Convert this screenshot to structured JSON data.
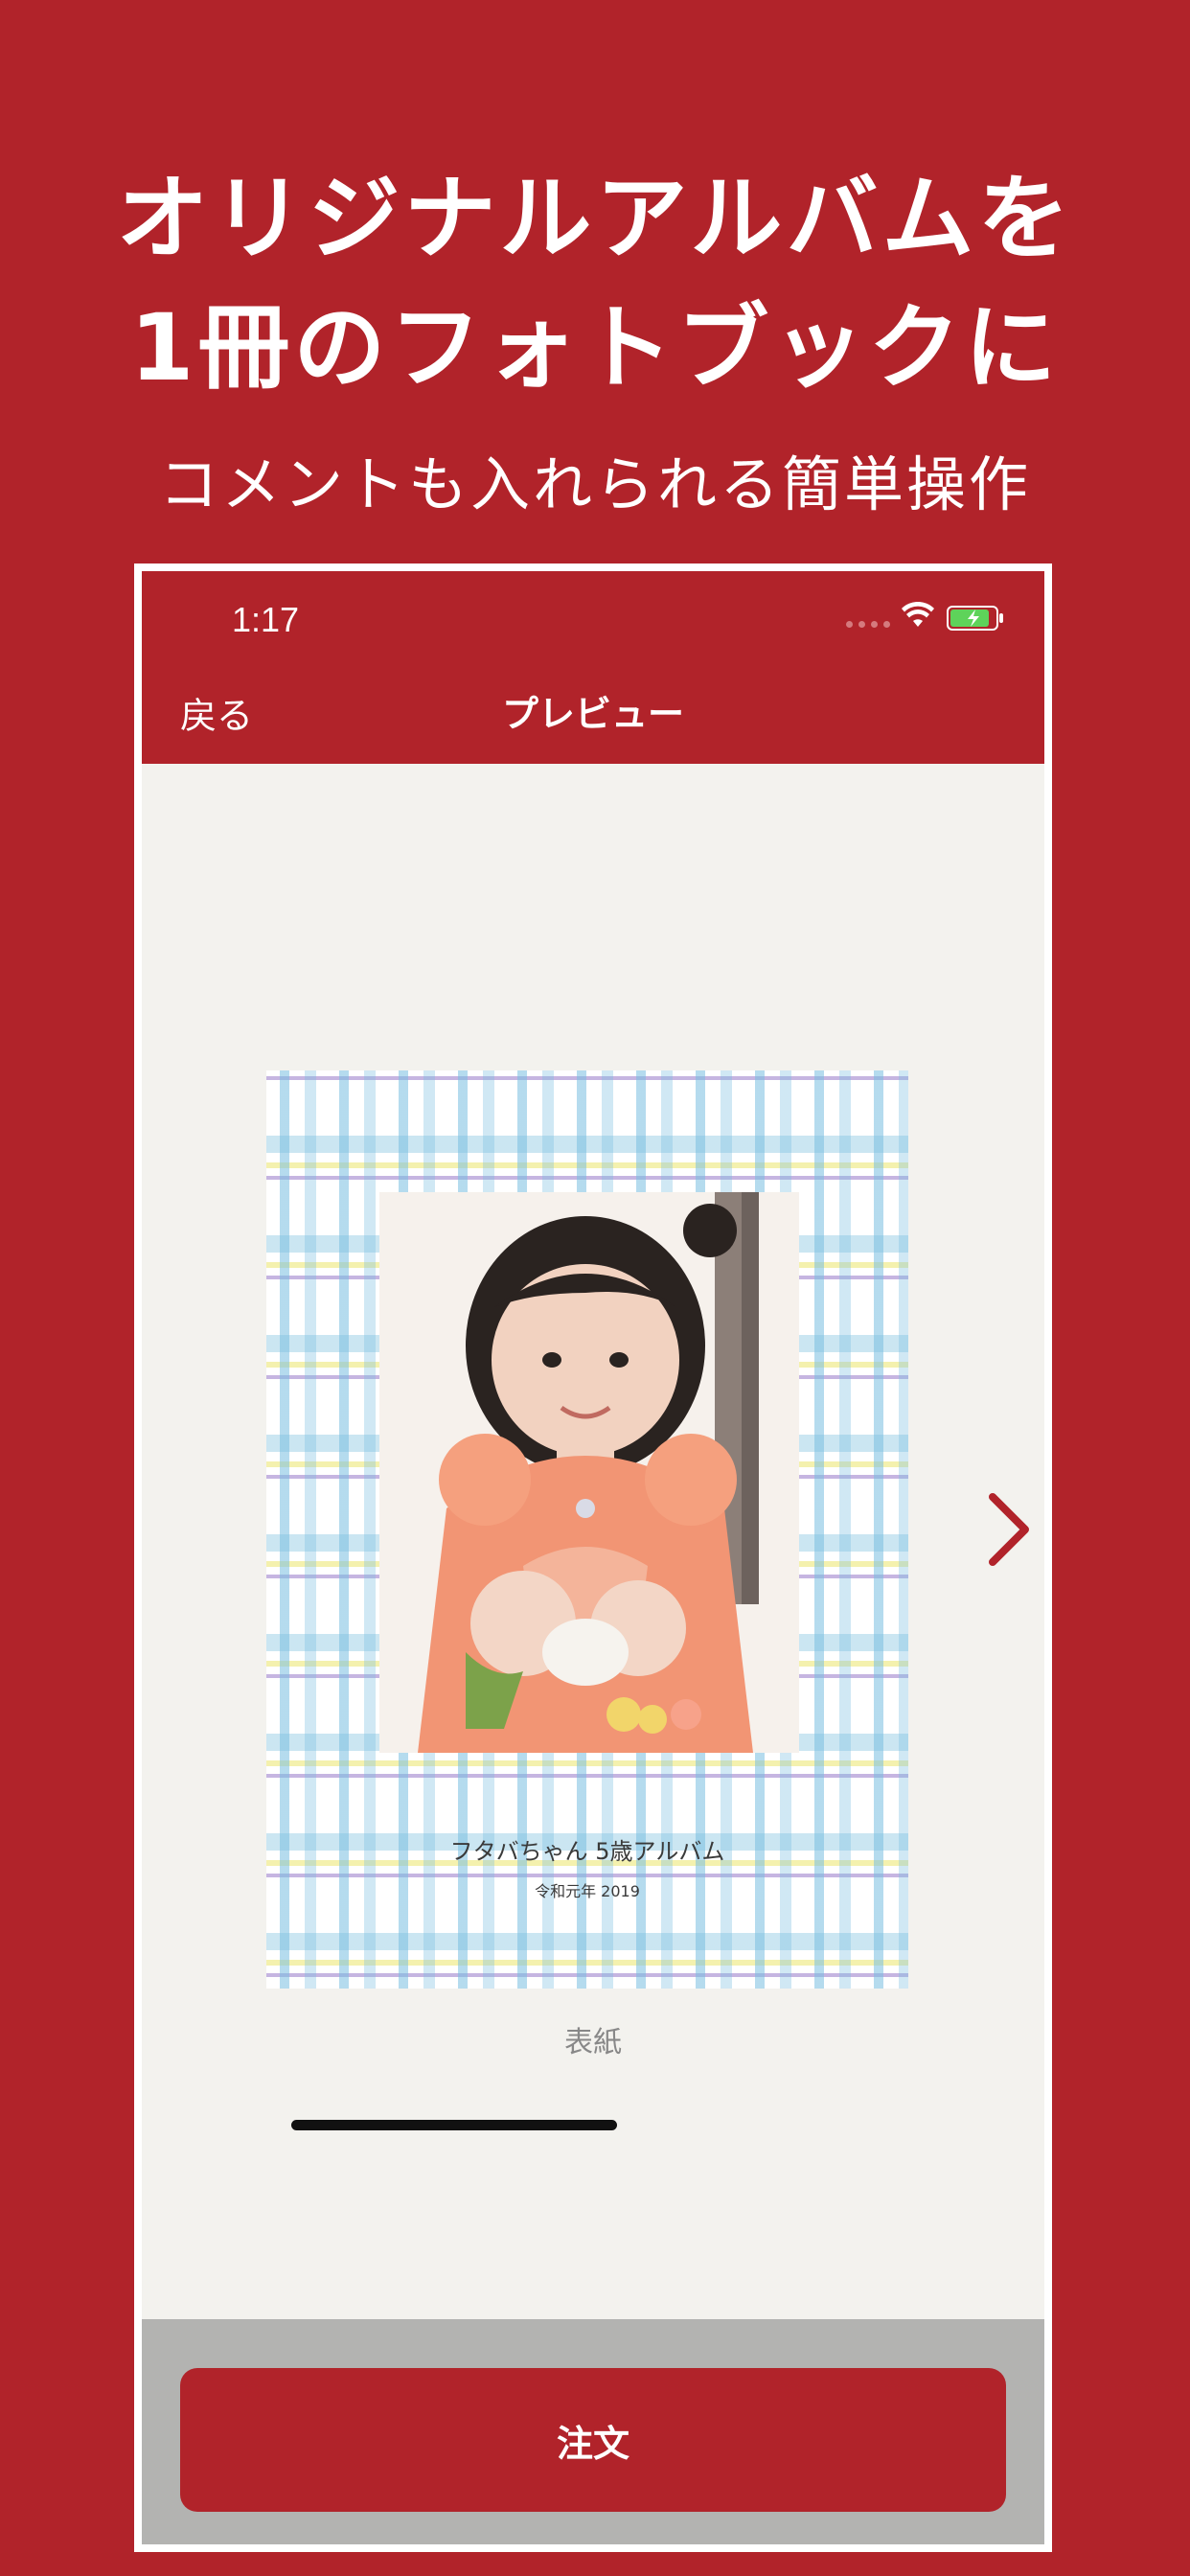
{
  "promo": {
    "headline_line1": "オリジナルアルバムを",
    "headline_line2": "1冊のフォトブックに",
    "subheadline": "コメントも入れられる簡単操作"
  },
  "status_bar": {
    "time": "1:17"
  },
  "nav": {
    "back_label": "戻る",
    "title": "プレビュー"
  },
  "cover": {
    "title": "フタバちゃん 5歳アルバム",
    "subtitle": "令和元年 2019",
    "label": "表紙"
  },
  "footer": {
    "order_label": "注文"
  },
  "icons": [
    "wifi-icon",
    "battery-charging-icon",
    "chevron-right-icon"
  ],
  "colors": {
    "brand": "#b1232a",
    "background": "#f3f2ee",
    "footer": "#b3b3b1"
  }
}
